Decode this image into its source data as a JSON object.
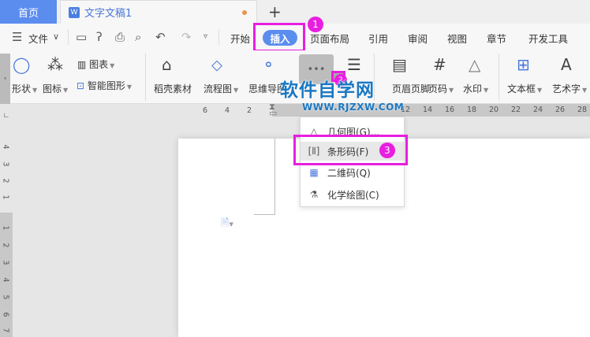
{
  "tabs": {
    "home": "首页",
    "doc_title": "文字文稿1",
    "doc_icon": "W",
    "new_tab": "+"
  },
  "menubar": {
    "file": "文件",
    "items": [
      "开始",
      "插入",
      "页面布局",
      "引用",
      "审阅",
      "视图",
      "章节",
      "开发工具"
    ],
    "active": "插入"
  },
  "ribbon": {
    "shape": "形状",
    "icon": "图标",
    "chart": "图表",
    "smart_art": "智能图形",
    "docer": "稻壳素材",
    "flowchart": "流程图",
    "mindmap": "思维导图",
    "more": "•••",
    "header_footer": "页眉页脚",
    "page_number": "页码",
    "watermark": "水印",
    "textbox": "文本框",
    "word_art": "艺术字"
  },
  "ruler": {
    "h_left": [
      "6",
      "4",
      "2"
    ],
    "h_right": [
      "12",
      "14",
      "16",
      "18",
      "20",
      "22",
      "24",
      "26",
      "28"
    ],
    "v_upper": [
      "4",
      "3",
      "2",
      "1"
    ],
    "v_lower": [
      "1",
      "2",
      "3",
      "4",
      "5",
      "6",
      "7"
    ]
  },
  "dropdown": {
    "items": [
      {
        "label": "几何图(G)...",
        "icon": "geometry-icon"
      },
      {
        "label": "条形码(F)",
        "icon": "barcode-icon"
      },
      {
        "label": "二维码(Q)",
        "icon": "qrcode-icon"
      },
      {
        "label": "化学绘图(C)",
        "icon": "flask-icon"
      }
    ]
  },
  "annotations": {
    "step1": "1",
    "step2": "2",
    "step3": "3"
  },
  "watermark": {
    "title": "软件自学网",
    "url": "WWW.RJZXW.COM"
  },
  "colors": {
    "accent": "#5b8def",
    "highlight": "#e81ee0",
    "watermark": "#1a78c2"
  }
}
